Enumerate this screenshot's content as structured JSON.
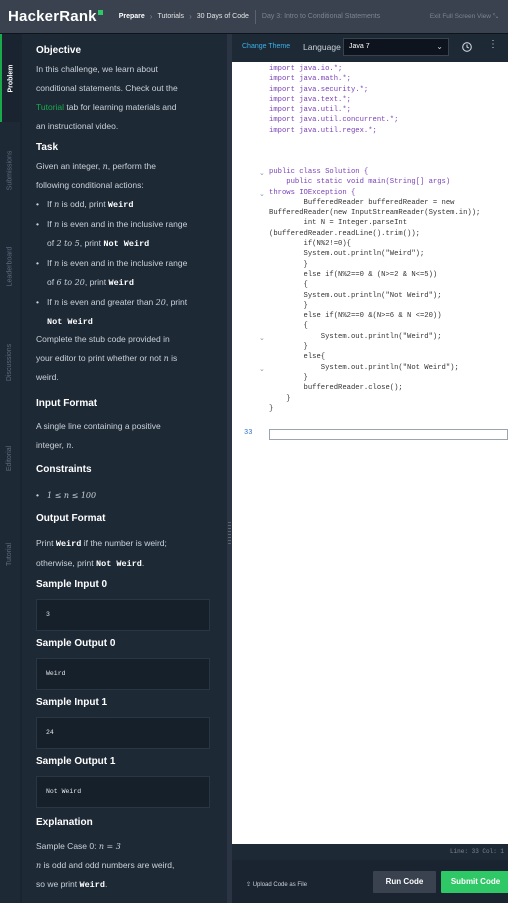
{
  "header": {
    "logo": "HackerRank",
    "breadcrumbs": [
      "Prepare",
      "Tutorials",
      "30 Days of Code"
    ],
    "current": "Day 3: Intro to Conditional Statements",
    "fullscreen": "Exit Full Screen View"
  },
  "tabs": [
    "Problem",
    "Submissions",
    "Leaderboard",
    "Discussions",
    "Editorial",
    "Tutorial"
  ],
  "problem": {
    "objective_title": "Objective",
    "objective_1": "In this challenge, we learn about",
    "objective_2": "conditional statements. Check out the",
    "objective_link": "Tutorial",
    "objective_3": " tab for learning materials and",
    "objective_4": "an instructional video.",
    "task_title": "Task",
    "task_1": "Given an integer, ",
    "task_var": "n",
    "task_2": ", perform the",
    "task_3": "following conditional actions:",
    "b1_pre": "If ",
    "b1_var": "n",
    "b1_mid": " is odd, print ",
    "b1_code": "Weird",
    "b2_l1_pre": "If ",
    "b2_l1_var": "n",
    "b2_l1_post": " is even and in the inclusive range",
    "b2_l2_pre": "of ",
    "b2_l2_range": "2 to 5",
    "b2_l2_mid": ", print ",
    "b2_code": "Not Weird",
    "b3_l1_pre": "If ",
    "b3_l1_var": "n",
    "b3_l1_post": " is even and in the inclusive range",
    "b3_l2_pre": "of ",
    "b3_l2_range": "6 to 20",
    "b3_l2_mid": ", print ",
    "b3_code": "Weird",
    "b4_l1_pre": "If ",
    "b4_l1_var": "n",
    "b4_l1_post": " is even and greater than ",
    "b4_l1_num": "20",
    "b4_l1_end": ", print",
    "b4_code": "Not Weird",
    "complete_1": "Complete the stub code provided in",
    "complete_2": "your editor to print whether or not ",
    "complete_var": "n",
    "complete_2b": " is",
    "complete_3": "weird.",
    "input_title": "Input Format",
    "input_1": "A single line containing a positive",
    "input_2": "integer, ",
    "input_var": "n",
    "input_end": ".",
    "constraints_title": "Constraints",
    "constraint": "1 ≤ n ≤ 100",
    "output_title": "Output Format",
    "output_1_pre": "Print ",
    "output_1_code": "Weird",
    "output_1_post": " if the number is weird;",
    "output_2_pre": "otherwise, print ",
    "output_2_code": "Not Weird",
    "output_2_post": ".",
    "si0_title": "Sample Input 0",
    "si0_val": "3",
    "so0_title": "Sample Output 0",
    "so0_val": "Weird",
    "si1_title": "Sample Input 1",
    "si1_val": "24",
    "so1_title": "Sample Output 1",
    "so1_val": "Not Weird",
    "expl_title": "Explanation",
    "expl_1_pre": "Sample Case 0: ",
    "expl_1_eq": "n = 3",
    "expl_2_var": "n",
    "expl_2_post": " is odd and odd numbers are weird,",
    "expl_3_pre": "so we print ",
    "expl_3_code": "Weird",
    "expl_3_post": "."
  },
  "editor": {
    "change_theme": "Change Theme",
    "language_label": "Language",
    "language": "Java 7",
    "imports": [
      "import java.io.*;",
      "import java.math.*;",
      "import java.security.*;",
      "import java.text.*;",
      "import java.util.*;",
      "import java.util.concurrent.*;",
      "import java.util.regex.*;"
    ],
    "code_lines": [
      "public class Solution {",
      "    public static void main(String[] args)",
      "throws IOException {",
      "        BufferedReader bufferedReader = new",
      "BufferedReader(new InputStreamReader(System.in));",
      "",
      "        int N = Integer.parseInt",
      "(bufferedReader.readLine().trim());",
      "        if(N%2!=0){",
      "        System.out.println(\"Weird\");",
      "        }",
      "        else if(N%2==0 & (N>=2 & N<=5))",
      "        {",
      "        System.out.println(\"Not Weird\");",
      "        }",
      "        else if(N%2==0 &(N>=6 & N <=20))",
      "        {",
      "            System.out.println(\"Weird\");",
      "        }",
      "        else{",
      "            System.out.println(\"Not Weird\");",
      "        }",
      "        bufferedReader.close();",
      "    }",
      "}"
    ],
    "last_line_number": "33",
    "status": "Line: 33 Col: 1"
  },
  "footer": {
    "upload": "Upload Code as File",
    "run": "Run Code",
    "submit": "Submit Code"
  },
  "colors": {
    "accent_green": "#2ec866",
    "link_blue": "#39b3e8",
    "bg_dark": "#1e2936"
  }
}
